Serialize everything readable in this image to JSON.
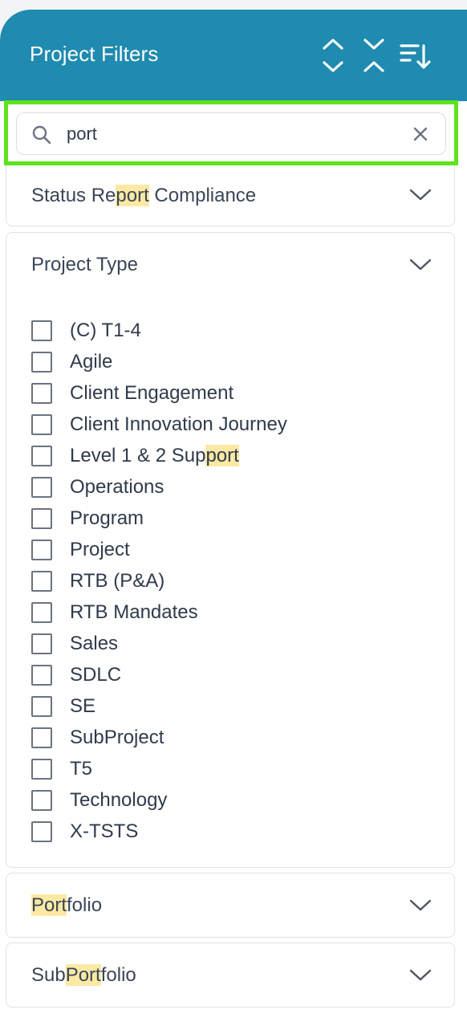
{
  "header": {
    "title": "Project Filters",
    "actions": [
      "expand-all-icon",
      "collapse-all-icon",
      "sort-icon"
    ],
    "background": "#1f8bb0"
  },
  "search": {
    "value": "port",
    "placeholder": "",
    "highlight_color": "#5ee31a"
  },
  "sections": {
    "status_report": {
      "title_parts": [
        "Status Re",
        "port",
        " Compliance"
      ],
      "expanded": false
    },
    "project_type": {
      "title": "Project Type",
      "expanded": true,
      "options": [
        {
          "parts": [
            "(C) T1-4"
          ],
          "checked": false
        },
        {
          "parts": [
            "Agile"
          ],
          "checked": false
        },
        {
          "parts": [
            "Client Engagement"
          ],
          "checked": false
        },
        {
          "parts": [
            "Client Innovation Journey"
          ],
          "checked": false
        },
        {
          "parts": [
            "Level 1 & 2 Sup",
            "port"
          ],
          "checked": false
        },
        {
          "parts": [
            "Operations"
          ],
          "checked": false
        },
        {
          "parts": [
            "Program"
          ],
          "checked": false
        },
        {
          "parts": [
            "Project"
          ],
          "checked": false
        },
        {
          "parts": [
            "RTB (P&A)"
          ],
          "checked": false
        },
        {
          "parts": [
            "RTB Mandates"
          ],
          "checked": false
        },
        {
          "parts": [
            "Sales"
          ],
          "checked": false
        },
        {
          "parts": [
            "SDLC"
          ],
          "checked": false
        },
        {
          "parts": [
            "SE"
          ],
          "checked": false
        },
        {
          "parts": [
            "SubProject"
          ],
          "checked": false
        },
        {
          "parts": [
            "T5"
          ],
          "checked": false
        },
        {
          "parts": [
            "Technology"
          ],
          "checked": false
        },
        {
          "parts": [
            "X-TSTS"
          ],
          "checked": false
        }
      ]
    },
    "portfolio": {
      "title_parts": [
        "",
        "Port",
        "folio"
      ],
      "expanded": false
    },
    "subportfolio": {
      "title_parts": [
        "Sub",
        "Port",
        "folio"
      ],
      "expanded": false
    }
  },
  "match_highlight_color": "#fde9a3"
}
